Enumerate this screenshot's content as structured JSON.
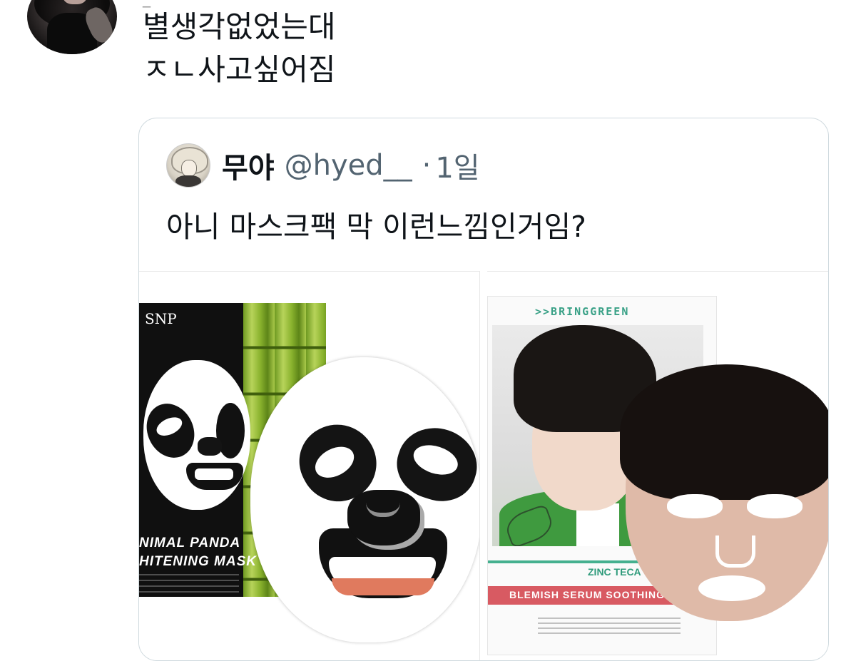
{
  "tweet": {
    "top_fragment": "_",
    "text_line1": "별생각없었는대",
    "text_line2": "ㅈㄴ사고싶어짐"
  },
  "quote": {
    "name": "무야",
    "handle": "@hyed__",
    "dot": "·",
    "time": "1일",
    "text": "아니 마스크팩 막 이런느낌인거임?"
  },
  "images": {
    "left": {
      "brand": "SNP",
      "title_line1": "NIMAL PANDA",
      "title_line2": "HITENING MASK"
    },
    "right": {
      "brand": ">>BRINGGREEN",
      "label1": "ZINC TECA",
      "label2": "BLEMISH SERUM SOOTHING M"
    }
  }
}
